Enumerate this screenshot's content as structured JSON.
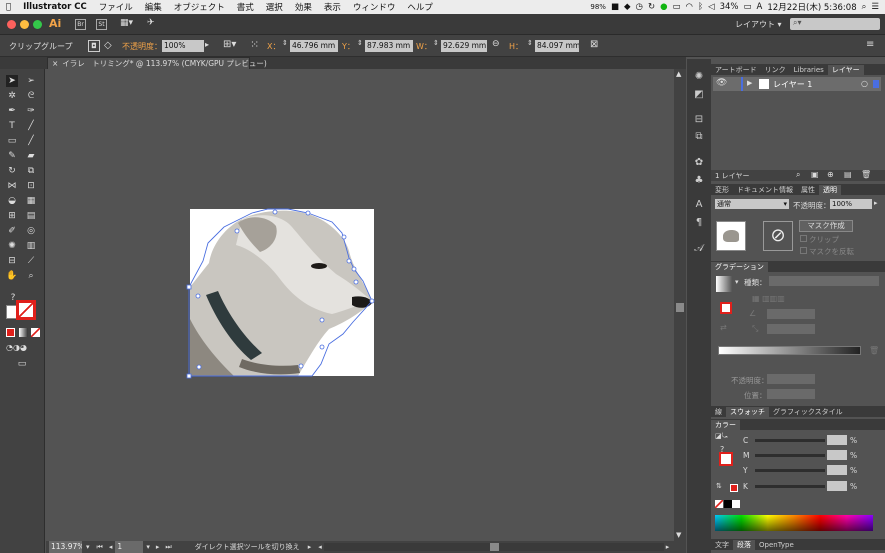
{
  "menubar": {
    "app_name": "Illustrator CC",
    "menus": [
      "ファイル",
      "編集",
      "オブジェクト",
      "書式",
      "選択",
      "効果",
      "表示",
      "ウィンドウ",
      "ヘルプ"
    ],
    "memory": "98%",
    "battery": "34%",
    "clock": "12月22日(木) 5:36:08"
  },
  "titlebar": {
    "workspace": "レイアウト",
    "apps": [
      "Ai",
      "Br",
      "St"
    ]
  },
  "control": {
    "selection_type": "クリップグループ",
    "opacity_label": "不透明度：",
    "opacity_value": "100%",
    "x_label": "X：",
    "x_value": "46.796 mm",
    "y_label": "Y：",
    "y_value": "87.983 mm",
    "w_label": "W：",
    "w_value": "92.629 mm",
    "h_label": "H：",
    "h_value": "84.097 mm"
  },
  "document": {
    "tab_title": "イラレ　トリミング* @ 113.97% (CMYK/GPU プレビュー)",
    "close_glyph": "×"
  },
  "status": {
    "zoom": "113.97%",
    "page": "1",
    "message": "ダイレクト選択ツールを切り換え"
  },
  "layers_panel": {
    "tabs": [
      "アートボード",
      "リンク",
      "Libraries",
      "レイヤー"
    ],
    "active_tab": "レイヤー",
    "layer_name": "レイヤー 1",
    "footer_count": "1 レイヤー"
  },
  "transparency_panel": {
    "tabs": [
      "変形",
      "ドキュメント情報",
      "属性",
      "透明"
    ],
    "blend_mode": "通常",
    "opacity_label": "不透明度：",
    "opacity_value": "100%",
    "make_mask": "マスク作成",
    "clip": "クリップ",
    "invert_mask": "マスクを反転"
  },
  "gradient_panel": {
    "title": "グラデーション",
    "type_label": "種類：",
    "opacity_label": "不透明度：",
    "position_label": "位置："
  },
  "swatch_tabs": {
    "tabs": [
      "線",
      "スウォッチ",
      "グラフィックスタイル"
    ],
    "active_tab": "スウォッチ"
  },
  "color_panel": {
    "title": "カラー",
    "channels": [
      {
        "label": "C",
        "value": "",
        "unit": "%"
      },
      {
        "label": "M",
        "value": "",
        "unit": "%"
      },
      {
        "label": "Y",
        "value": "",
        "unit": "%"
      },
      {
        "label": "K",
        "value": "",
        "unit": "%"
      }
    ]
  },
  "char_tabs": {
    "tabs": [
      "文字",
      "段落",
      "OpenType"
    ],
    "active_tab": "段落"
  },
  "colors": {
    "selection": "#4a6ee0",
    "highlight_orange": "#f2a348",
    "fill_red": "#e0201b"
  }
}
